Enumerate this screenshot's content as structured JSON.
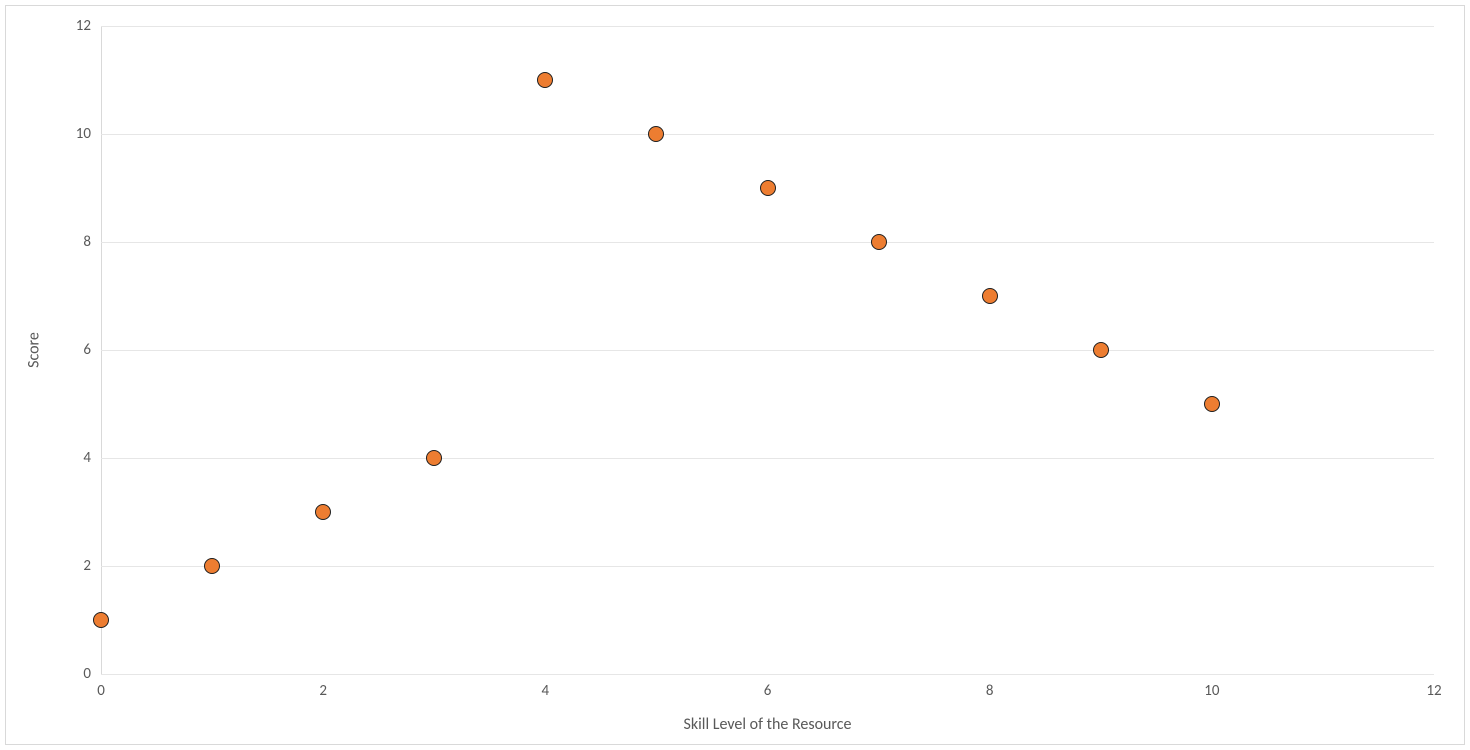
{
  "chart_data": {
    "type": "scatter",
    "x": [
      0,
      1,
      2,
      3,
      4,
      5,
      6,
      7,
      8,
      9,
      10
    ],
    "y": [
      1,
      2,
      3,
      4,
      11,
      10,
      9,
      8,
      7,
      6,
      5
    ],
    "xlabel": "Skill Level of the Resource",
    "ylabel": "Score",
    "xlim": [
      0,
      12
    ],
    "ylim": [
      0,
      12
    ],
    "x_ticks": [
      0,
      2,
      4,
      6,
      8,
      10,
      12
    ],
    "y_ticks": [
      0,
      2,
      4,
      6,
      8,
      10,
      12
    ],
    "marker_color": "#ed7d31",
    "marker_border": "#1f1f1f"
  }
}
